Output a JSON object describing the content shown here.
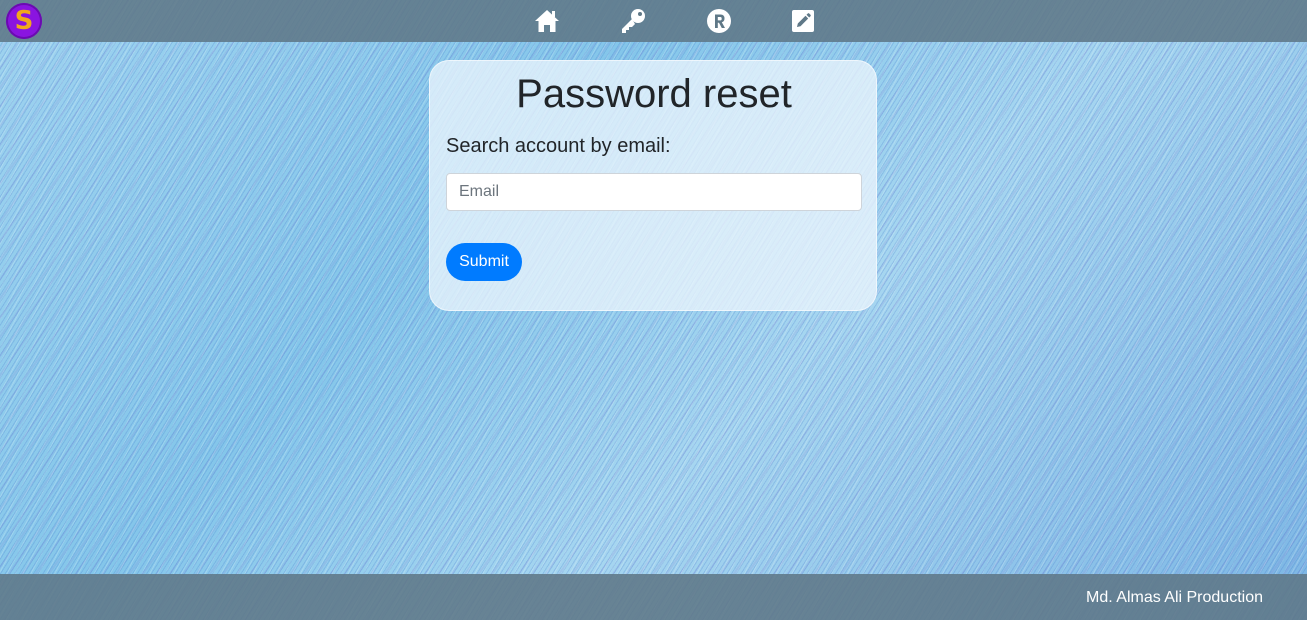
{
  "header": {
    "logo_letter": "S",
    "nav": [
      {
        "icon": "home-icon"
      },
      {
        "icon": "key-icon"
      },
      {
        "icon": "registered-icon"
      },
      {
        "icon": "edit-icon"
      }
    ]
  },
  "card": {
    "title": "Password reset",
    "search_label": "Search account by email:",
    "email_placeholder": "Email",
    "email_value": "",
    "submit_label": "Submit"
  },
  "footer": {
    "text": "Md. Almas Ali Production"
  },
  "colors": {
    "primary_button": "#007bff",
    "logo_bg": "#8a14e0",
    "logo_letter": "#f2a81c",
    "bar_bg": "#5f7887"
  }
}
